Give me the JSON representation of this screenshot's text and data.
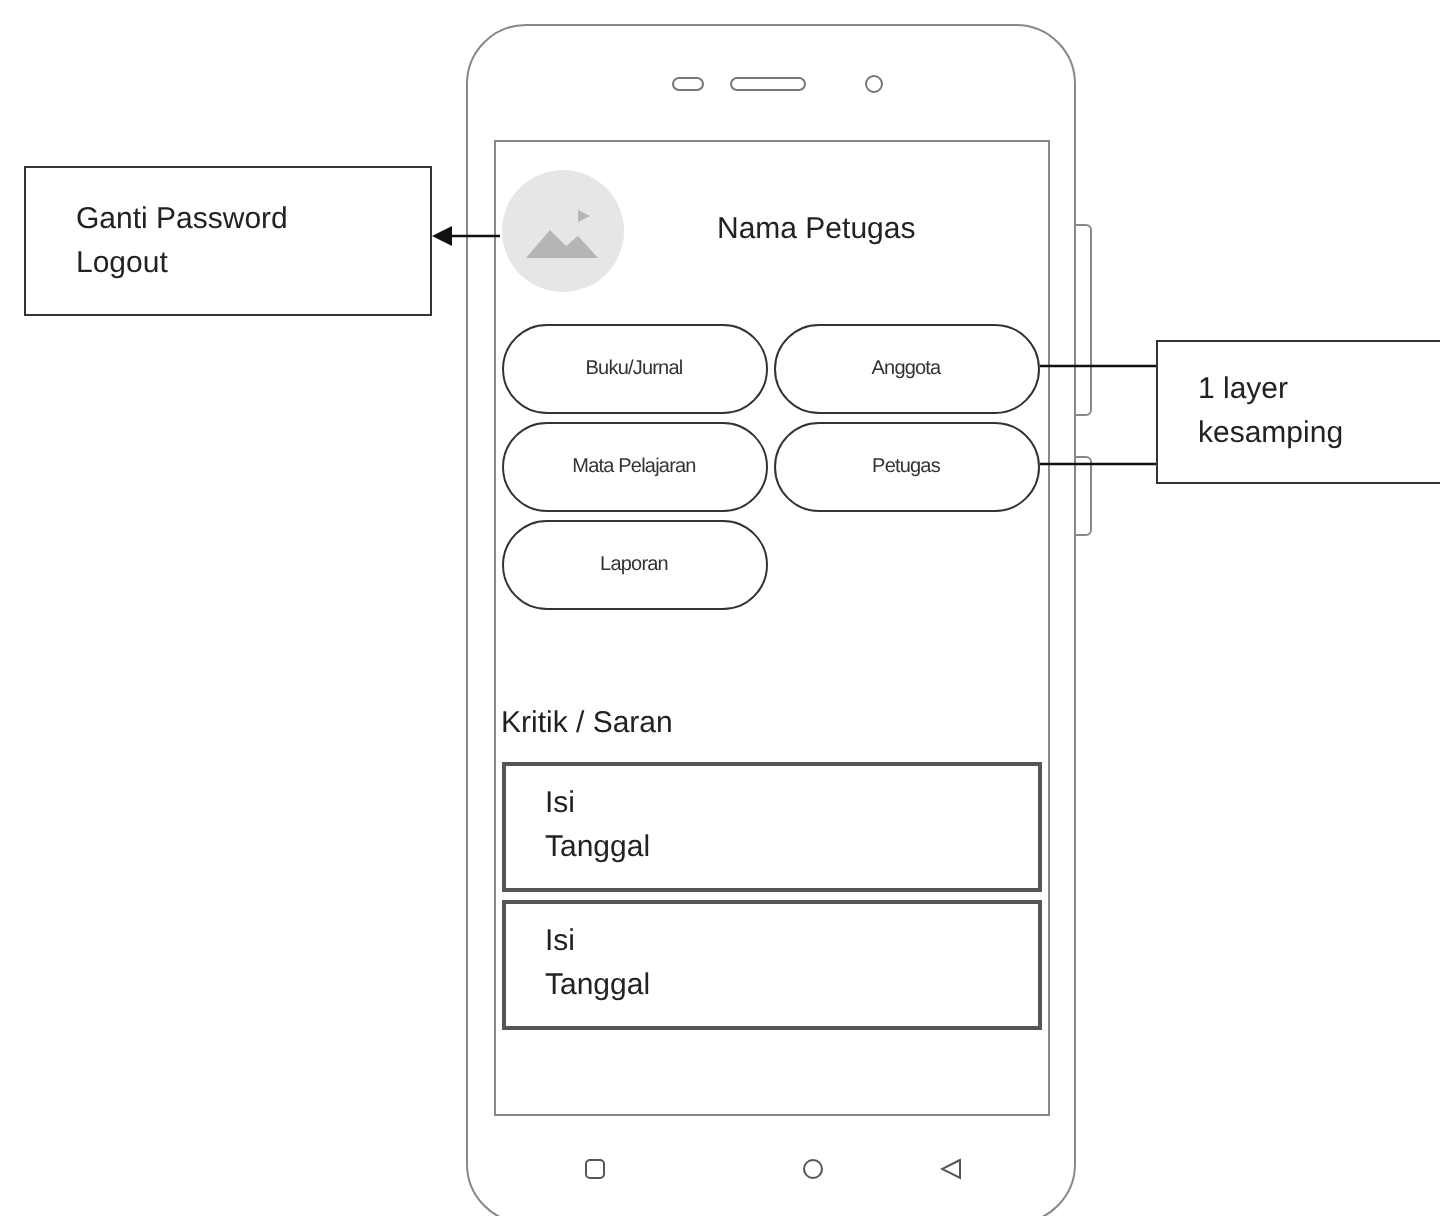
{
  "annotations": [
    {
      "lines": [
        "Ganti Password",
        "Logout"
      ]
    },
    {
      "lines": [
        "1 layer",
        "kesamping"
      ]
    }
  ],
  "profile": {
    "name": "Nama Petugas"
  },
  "menu_buttons": [
    {
      "label": "Buku/Jurnal"
    },
    {
      "label": "Anggota"
    },
    {
      "label": "Mata Pelajaran"
    },
    {
      "label": "Petugas"
    },
    {
      "label": "Laporan"
    }
  ],
  "feedback": {
    "title": "Kritik / Saran",
    "items": [
      {
        "content": "Isi",
        "date": "Tanggal"
      },
      {
        "content": "Isi",
        "date": "Tanggal"
      }
    ]
  }
}
